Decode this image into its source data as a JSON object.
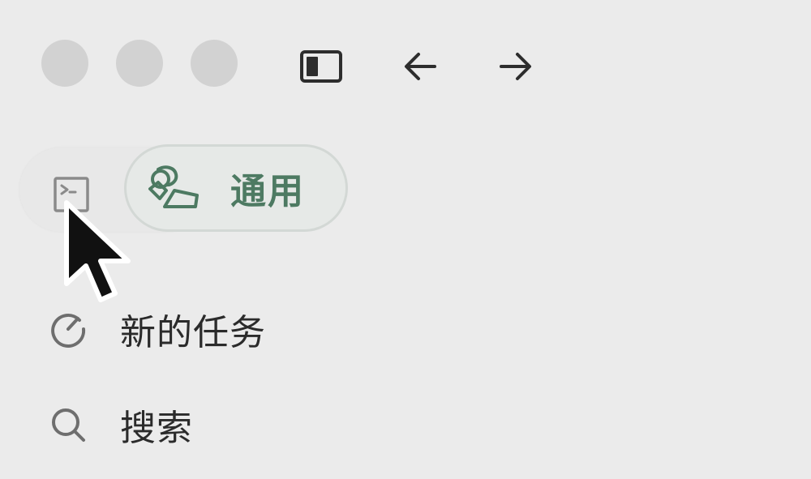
{
  "window": {
    "traffic_lights": [
      "close",
      "minimize",
      "zoom"
    ]
  },
  "toolbar": {
    "sidebar_toggle_icon": "sidebar-toggle-icon",
    "back_icon": "arrow-left-icon",
    "forward_icon": "arrow-right-icon"
  },
  "mode_switch": {
    "terminal_icon": "terminal-icon",
    "general_icon": "shapes-icon",
    "general_label": "通用",
    "active_color": "#4d7a62"
  },
  "nav": {
    "items": [
      {
        "icon": "new-task-icon",
        "label": "新的任务"
      },
      {
        "icon": "search-icon",
        "label": "搜索"
      }
    ]
  },
  "colors": {
    "background": "#ebebeb",
    "traffic_light": "#d2d2d2",
    "text": "#2b2b2b",
    "icon": "#2d2d2d"
  }
}
